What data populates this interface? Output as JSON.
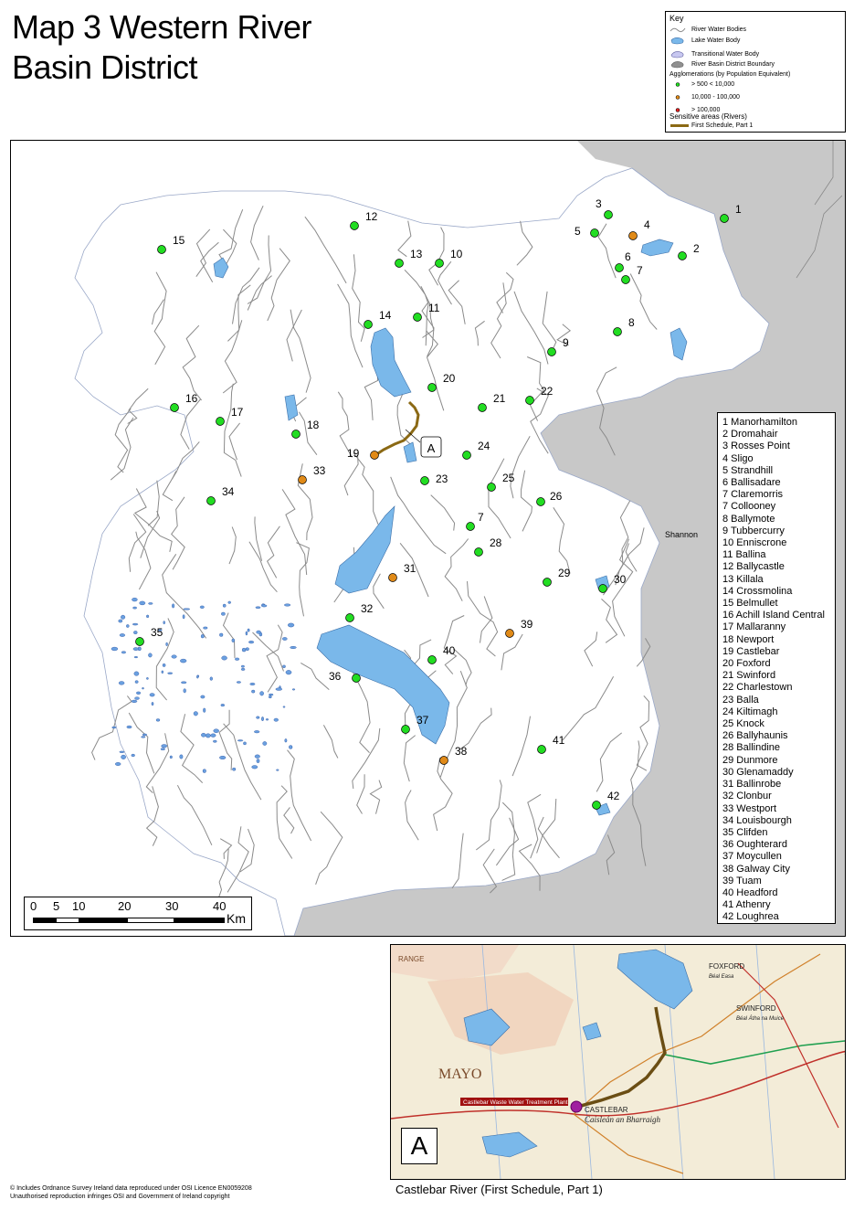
{
  "title": {
    "line1": "Map 3 Western River",
    "line2": "Basin District"
  },
  "key": {
    "title": "Key",
    "items": [
      {
        "label": "River Water Bodies",
        "symbol": "river-line"
      },
      {
        "label": "Lake Water Body",
        "symbol": "lake-fill"
      },
      {
        "label": "Transitional Water Body",
        "symbol": "transitional-fill"
      },
      {
        "label": "River Basin District Boundary",
        "symbol": "grey-fill"
      }
    ],
    "agglomerations_header": "Agglomerations (by Population Equivalent)",
    "agglomerations": [
      {
        "label": "> 500 < 10,000",
        "color": "#22dd22"
      },
      {
        "label": "10,000 - 100,000",
        "color": "#e08a18"
      },
      {
        "label": "> 100,000",
        "color": "#e02020"
      }
    ],
    "sensitive_header": "Sensitive areas (Rivers)",
    "sensitive_item": "First Schedule, Part 1",
    "sensitive_color": "#8b6914"
  },
  "colors": {
    "lake": "#7ab8ea",
    "river": "#8a8a8a",
    "land": "#ffffff",
    "neighbour": "#c8c8c8",
    "green": "#22dd22",
    "orange": "#e08a18"
  },
  "map_labels": {
    "point_a": "A",
    "shannon": "Shannon"
  },
  "towns": [
    {
      "num": "1",
      "name": "Manorhamilton",
      "size": "small"
    },
    {
      "num": "2",
      "name": "Dromahair",
      "size": "small"
    },
    {
      "num": "3",
      "name": "Rosses Point",
      "size": "small"
    },
    {
      "num": "4",
      "name": "Sligo",
      "size": "medium"
    },
    {
      "num": "5",
      "name": "Strandhill",
      "size": "small"
    },
    {
      "num": "6",
      "name": "Ballisadare",
      "size": "small"
    },
    {
      "num": "7",
      "name": "Claremorris",
      "size": "small"
    },
    {
      "num": "7",
      "name": "Collooney",
      "size": "small"
    },
    {
      "num": "8",
      "name": "Ballymote",
      "size": "small"
    },
    {
      "num": "9",
      "name": "Tubbercurry",
      "size": "small"
    },
    {
      "num": "10",
      "name": "Enniscrone",
      "size": "small"
    },
    {
      "num": "11",
      "name": "Ballina",
      "size": "small"
    },
    {
      "num": "12",
      "name": "Ballycastle",
      "size": "small"
    },
    {
      "num": "13",
      "name": "Killala",
      "size": "small"
    },
    {
      "num": "14",
      "name": "Crossmolina",
      "size": "small"
    },
    {
      "num": "15",
      "name": "Belmullet",
      "size": "small"
    },
    {
      "num": "16",
      "name": "Achill Island Central",
      "size": "small"
    },
    {
      "num": "17",
      "name": "Mallaranny",
      "size": "small"
    },
    {
      "num": "18",
      "name": "Newport",
      "size": "small"
    },
    {
      "num": "19",
      "name": "Castlebar",
      "size": "medium"
    },
    {
      "num": "20",
      "name": "Foxford",
      "size": "small"
    },
    {
      "num": "21",
      "name": "Swinford",
      "size": "small"
    },
    {
      "num": "22",
      "name": "Charlestown",
      "size": "small"
    },
    {
      "num": "23",
      "name": "Balla",
      "size": "small"
    },
    {
      "num": "24",
      "name": "Kiltimagh",
      "size": "small"
    },
    {
      "num": "25",
      "name": "Knock",
      "size": "small"
    },
    {
      "num": "26",
      "name": "Ballyhaunis",
      "size": "small"
    },
    {
      "num": "28",
      "name": "Ballindine",
      "size": "small"
    },
    {
      "num": "29",
      "name": "Dunmore",
      "size": "small"
    },
    {
      "num": "30",
      "name": "Glenamaddy",
      "size": "small"
    },
    {
      "num": "31",
      "name": "Ballinrobe",
      "size": "medium"
    },
    {
      "num": "32",
      "name": "Clonbur",
      "size": "small"
    },
    {
      "num": "33",
      "name": "Westport",
      "size": "medium"
    },
    {
      "num": "34",
      "name": "Louisbourgh",
      "size": "small"
    },
    {
      "num": "35",
      "name": "Clifden",
      "size": "small"
    },
    {
      "num": "36",
      "name": "Oughterard",
      "size": "small"
    },
    {
      "num": "37",
      "name": "Moycullen",
      "size": "small"
    },
    {
      "num": "38",
      "name": "Galway City",
      "size": "medium"
    },
    {
      "num": "39",
      "name": "Tuam",
      "size": "medium"
    },
    {
      "num": "40",
      "name": "Headford",
      "size": "small"
    },
    {
      "num": "41",
      "name": "Athenry",
      "size": "small"
    },
    {
      "num": "42",
      "name": "Loughrea",
      "size": "small"
    }
  ],
  "scale": {
    "ticks": [
      "0",
      "5",
      "10",
      "20",
      "30",
      "40"
    ],
    "unit": "Km"
  },
  "inset": {
    "label": "A",
    "caption": "Castlebar River (First Schedule, Part 1)",
    "place_labels": [
      "MAYO",
      "CASTLEBAR",
      "Caisleán an Bharraigh",
      "Castlebar Waste Water Treatment Plant",
      "FOXFORD",
      "SWINFORD",
      "RANGE",
      "Béal Easa",
      "Béal Átha na Muice"
    ]
  },
  "copyright": {
    "line1": "© Includes Ordnance Survey Ireland data reproduced under OSI Licence EN0059208",
    "line2": "Unauthorised reproduction infringes OSI and Government of Ireland copyright"
  }
}
